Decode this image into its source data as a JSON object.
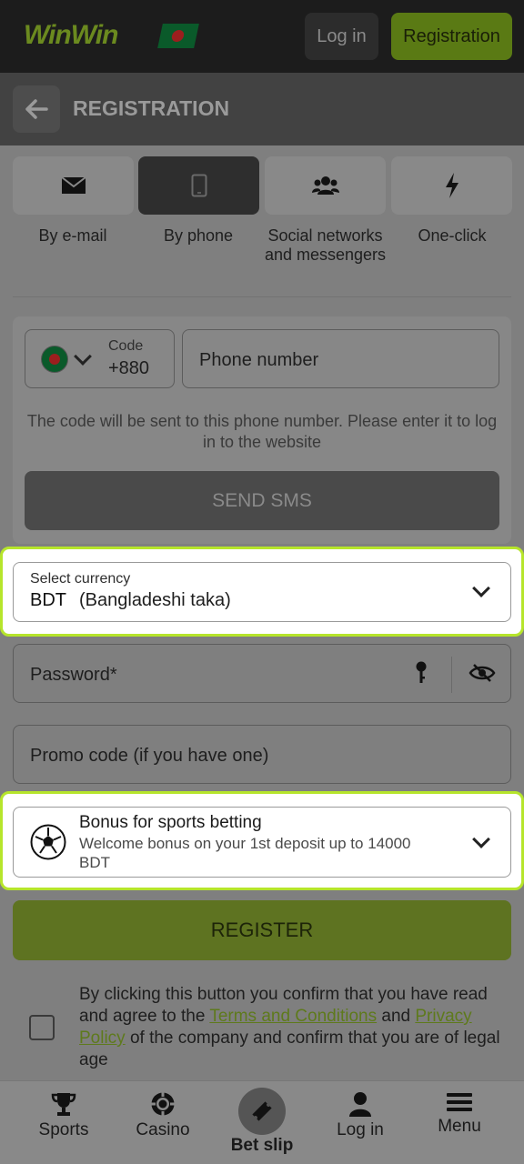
{
  "header": {
    "logo_text": "WinWin",
    "login_label": "Log in",
    "register_label": "Registration"
  },
  "page": {
    "title": "REGISTRATION"
  },
  "methods": [
    {
      "label": "By e-mail",
      "icon": "envelope-icon"
    },
    {
      "label": "By phone",
      "icon": "phone-icon",
      "active": true
    },
    {
      "label": "Social networks and messengers",
      "icon": "users-icon"
    },
    {
      "label": "One-click",
      "icon": "lightning-icon"
    }
  ],
  "phone_form": {
    "code_label": "Code",
    "code_value": "+880",
    "phone_placeholder": "Phone number",
    "hint": "The code will be sent to this phone number. Please enter it to log in to the website",
    "send_sms_label": "SEND SMS"
  },
  "currency": {
    "label": "Select currency",
    "code": "BDT",
    "name": "(Bangladeshi taka)"
  },
  "password": {
    "placeholder": "Password*"
  },
  "promo": {
    "placeholder": "Promo code (if you have one)"
  },
  "bonus": {
    "title": "Bonus for sports betting",
    "description": "Welcome bonus on your 1st deposit up to 14000 BDT"
  },
  "register_button": "REGISTER",
  "consent": {
    "text_1": "By clicking this button you confirm that you have read and agree to the ",
    "terms_link": "Terms and Conditions",
    "text_2": " and ",
    "privacy_link": "Privacy Policy",
    "text_3": " of the company and confirm that you are of legal age"
  },
  "bottom_nav": {
    "sports": "Sports",
    "casino": "Casino",
    "bet_slip": "Bet slip",
    "login": "Log in",
    "menu": "Menu"
  },
  "colors": {
    "accent": "#b6e52b",
    "brand_green": "#5e7321",
    "link": "#5e7a1c"
  }
}
